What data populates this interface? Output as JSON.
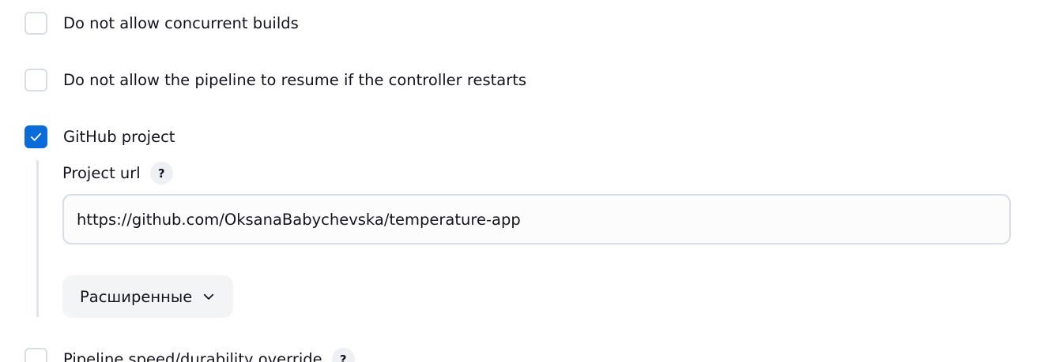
{
  "options": {
    "no_concurrent_builds": {
      "label": "Do not allow concurrent builds",
      "checked": false
    },
    "no_resume": {
      "label": "Do not allow the pipeline to resume if the controller restarts",
      "checked": false
    },
    "github_project": {
      "label": "GitHub project",
      "checked": true
    },
    "durability_override": {
      "label": "Pipeline speed/durability override",
      "checked": false
    }
  },
  "github": {
    "project_url_label": "Project url",
    "help_glyph": "?",
    "project_url_value": "https://github.com/OksanaBabychevska/temperature-app",
    "advanced_button_label": "Расширенные"
  },
  "colors": {
    "accent": "#0b6bd8",
    "checkbox_border": "#d8dde6",
    "text": "#14141f",
    "button_bg": "#f3f4f6"
  },
  "icons": {
    "check": "check-icon",
    "advanced_toggle": "chevron-down-icon",
    "help": "help-icon"
  }
}
